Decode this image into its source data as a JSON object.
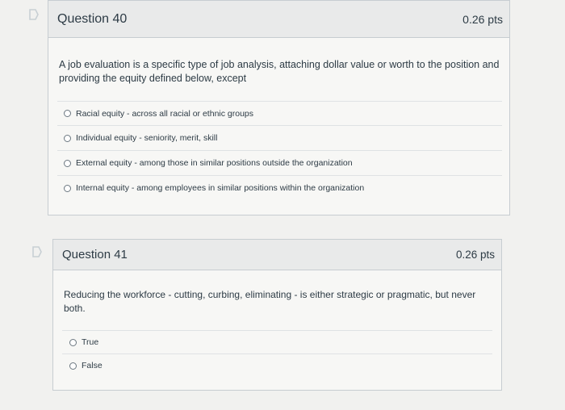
{
  "questions": [
    {
      "title": "Question 40",
      "points": "0.26 pts",
      "text": "A job evaluation is a specific type of job analysis, attaching dollar value or worth to the position and providing the equity defined below, except",
      "answers": [
        "Racial equity - across all racial or ethnic groups",
        "Individual equity - seniority, merit, skill",
        "External equity - among those in similar positions outside the organization",
        "Internal equity - among employees in similar positions within the organization"
      ]
    },
    {
      "title": "Question 41",
      "points": "0.26 pts",
      "text": "Reducing the workforce - cutting, curbing, eliminating - is either strategic or pragmatic, but never both.",
      "answers": [
        "True",
        "False"
      ]
    }
  ],
  "icons": {
    "flag": "bookmark-flag-icon"
  },
  "colors": {
    "flag": "#c8cfd4",
    "border": "#c7cdd1",
    "header_bg": "#e9eaea",
    "text": "#2d3b45"
  }
}
